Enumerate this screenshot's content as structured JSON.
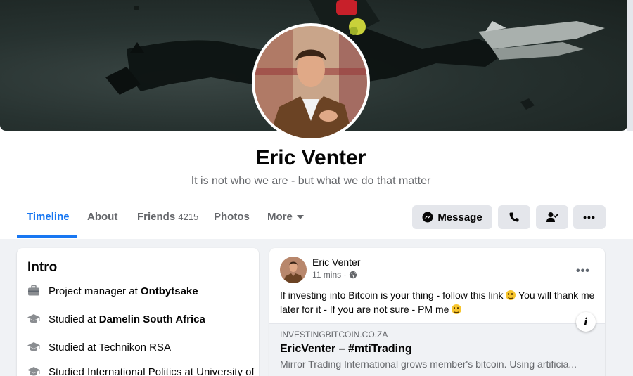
{
  "profile": {
    "name": "Eric Venter",
    "bio": "It is not who we are - but what we do that matter"
  },
  "tabs": [
    {
      "label": "Timeline",
      "active": true
    },
    {
      "label": "About"
    },
    {
      "label": "Friends",
      "count": "4215"
    },
    {
      "label": "Photos"
    },
    {
      "label": "More"
    }
  ],
  "actions": {
    "message_label": "Message",
    "call_icon": "phone-icon",
    "friend_icon": "friend-status-icon",
    "more_icon": "more-options-icon"
  },
  "intro": {
    "title": "Intro",
    "items": [
      {
        "icon": "briefcase-icon",
        "prefix": "Project manager at ",
        "bold": "Ontbytsake"
      },
      {
        "icon": "graduation-cap-icon",
        "prefix": "Studied at ",
        "bold": "Damelin South Africa"
      },
      {
        "icon": "graduation-cap-icon",
        "prefix": "Studied at Technikon RSA",
        "bold": ""
      },
      {
        "icon": "graduation-cap-icon",
        "prefix": "Studied International Politics at University of",
        "bold": ""
      }
    ]
  },
  "post": {
    "author": "Eric Venter",
    "time": "11 mins · ",
    "text_1": "If investing into Bitcoin is your thing - follow this link ",
    "text_2": " You will thank me later for it - If you are not sure - PM me ",
    "link": {
      "domain": "INVESTINGBITCOIN.CO.ZA",
      "title": "EricVenter – #mtiTrading",
      "description": "Mirror Trading International grows member's bitcoin. Using artificia..."
    }
  },
  "colors": {
    "accent": "#1877f2",
    "button_bg": "#e4e6eb",
    "page_bg": "#f0f2f5",
    "secondary_text": "#65676b"
  }
}
